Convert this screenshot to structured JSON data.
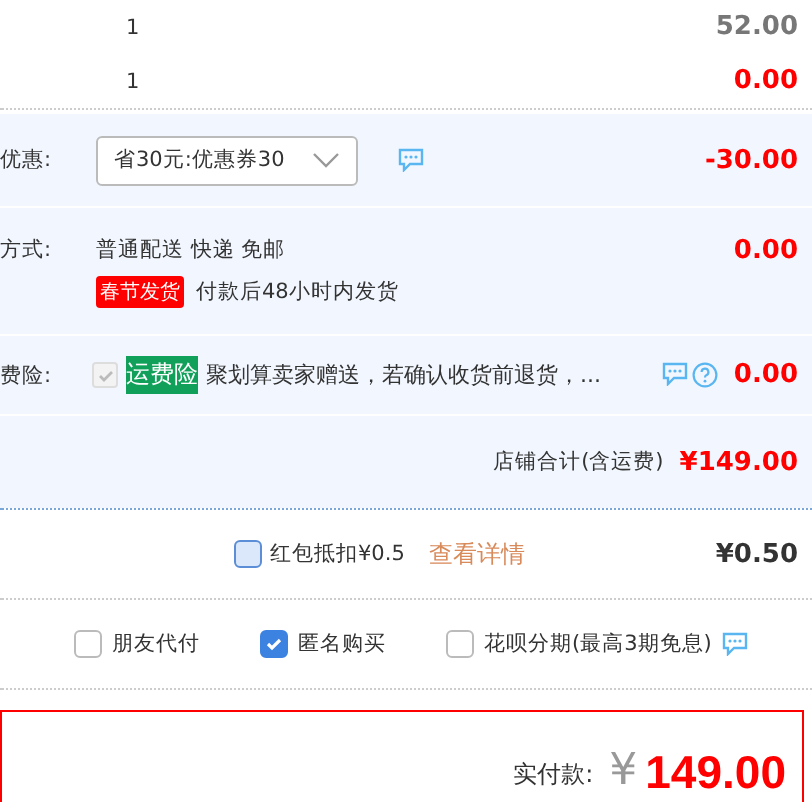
{
  "items": [
    {
      "quantity": "1",
      "price": "52.00",
      "highlight": false
    },
    {
      "quantity": "1",
      "price": "0.00",
      "highlight": true
    }
  ],
  "coupon": {
    "label": "优惠:",
    "value": "省30元:优惠券30",
    "amount": "-30.00"
  },
  "shipping": {
    "label": "方式:",
    "method": "普通配送 快递 免邮",
    "badge": "春节发货",
    "note": "付款后48小时内发货",
    "amount": "0.00"
  },
  "insurance": {
    "label": "费险:",
    "checked": true,
    "disabled": true,
    "tag": "运费险",
    "text": "聚划算卖家赠送，若确认收货前退货，...",
    "amount": "0.00"
  },
  "shop_total": {
    "label": "店铺合计(含运费)",
    "amount": "¥149.00"
  },
  "red_packet": {
    "checked": false,
    "label": "红包抵扣¥0.5",
    "link": "查看详情",
    "amount": "¥0.50"
  },
  "options": [
    {
      "label": "朋友代付",
      "checked": false,
      "help": false
    },
    {
      "label": "匿名购买",
      "checked": true,
      "help": false
    },
    {
      "label": "花呗分期(最高3期免息)",
      "checked": false,
      "help": true
    }
  ],
  "payment": {
    "label": "实付款:",
    "currency": "¥",
    "amount": "149.00"
  }
}
